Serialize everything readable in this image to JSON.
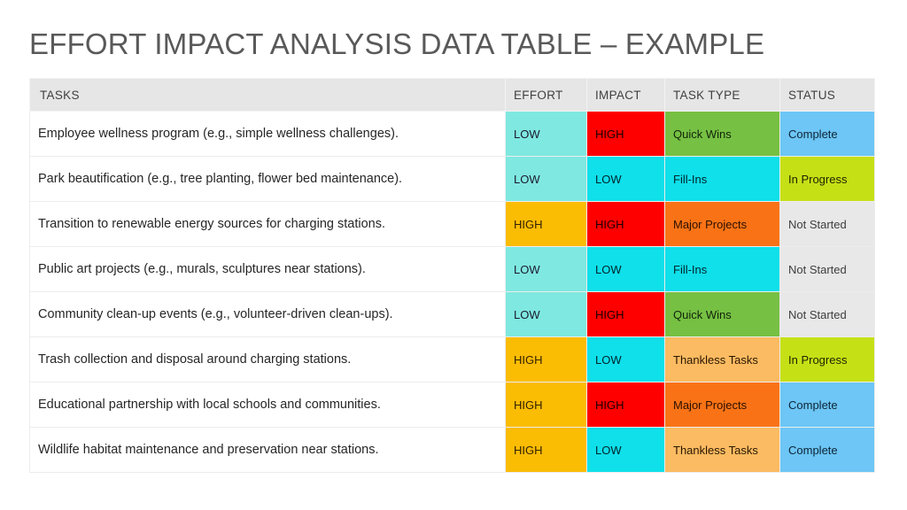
{
  "slide": {
    "title": "EFFORT IMPACT ANALYSIS DATA TABLE – EXAMPLE"
  },
  "table": {
    "columns": [
      {
        "key": "task",
        "label": "TASKS"
      },
      {
        "key": "effort",
        "label": "EFFORT"
      },
      {
        "key": "impact",
        "label": "IMPACT"
      },
      {
        "key": "type",
        "label": "TASK TYPE"
      },
      {
        "key": "status",
        "label": "STATUS"
      }
    ],
    "rows": [
      {
        "task": "Employee wellness program (e.g., simple wellness challenges).",
        "effort": "LOW",
        "impact": "HIGH",
        "type": "Quick Wins",
        "status": "Complete"
      },
      {
        "task": "Park beautification (e.g., tree planting, flower bed maintenance).",
        "effort": "LOW",
        "impact": "LOW",
        "type": "Fill-Ins",
        "status": "In Progress"
      },
      {
        "task": "Transition to renewable energy sources for charging stations.",
        "effort": "HIGH",
        "impact": "HIGH",
        "type": "Major Projects",
        "status": "Not Started"
      },
      {
        "task": "Public art projects (e.g., murals, sculptures near stations).",
        "effort": "LOW",
        "impact": "LOW",
        "type": "Fill-Ins",
        "status": "Not Started"
      },
      {
        "task": "Community clean-up events (e.g., volunteer-driven clean-ups).",
        "effort": "LOW",
        "impact": "HIGH",
        "type": "Quick Wins",
        "status": "Not Started"
      },
      {
        "task": "Trash collection and disposal around charging stations.",
        "effort": "HIGH",
        "impact": "LOW",
        "type": "Thankless Tasks",
        "status": "In Progress"
      },
      {
        "task": "Educational partnership with local schools and communities.",
        "effort": "HIGH",
        "impact": "HIGH",
        "type": "Major Projects",
        "status": "Complete"
      },
      {
        "task": "Wildlife habitat maintenance and preservation near stations.",
        "effort": "HIGH",
        "impact": "LOW",
        "type": "Thankless Tasks",
        "status": "Complete"
      }
    ]
  },
  "colors": {
    "title_text": "#595959",
    "header_bg": "#e6e6e6",
    "effort_low": "#7fe8e0",
    "effort_high": "#fbbc04",
    "impact_high": "#ff0000",
    "impact_low": "#0fe0ea",
    "type_quick_wins": "#76c043",
    "type_fill_ins": "#0fe0ea",
    "type_major_projects": "#f97316",
    "type_thankless_tasks": "#fbbb62",
    "status_complete": "#6dc6f5",
    "status_in_progress": "#c6e016",
    "status_not_started": "#e8e8e8"
  }
}
